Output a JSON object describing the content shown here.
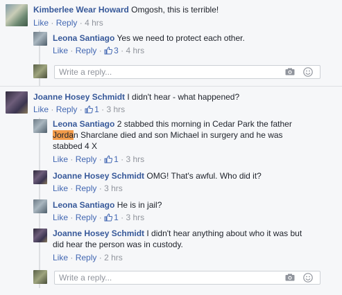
{
  "actions": {
    "like": "Like",
    "reply": "Reply",
    "sep": "·"
  },
  "comments": [
    {
      "name": "Kimberlee Wear Howard",
      "text": "Omgosh, this is terrible!",
      "likes": "",
      "time": "4 hrs"
    },
    {
      "name": "Leona Santiago",
      "text": "Yes we need to protect each other.",
      "likes": "3",
      "time": "4 hrs"
    },
    {
      "name": "Joanne Hosey Schmidt",
      "text": "I didn't hear - what happened?",
      "likes": "1",
      "time": "3 hrs"
    },
    {
      "name": "Leona Santiago",
      "text_pre": "2 stabbed this morning in Cedar Park the father",
      "text_hl": "Jorda",
      "text_post": "n Sharclane died and son Michael in surgery and he was",
      "text_line3": "stabbed 4 X",
      "likes": "1",
      "time": "3 hrs"
    },
    {
      "name": "Joanne Hosey Schmidt",
      "text": "OMG! That's awful. Who did it?",
      "likes": "",
      "time": "3 hrs"
    },
    {
      "name": "Leona Santiago",
      "text": "He is in jail?",
      "likes": "1",
      "time": "3 hrs"
    },
    {
      "name": "Joanne Hosey Schmidt",
      "text": "I didn't hear anything about who it was but",
      "text_line2": "did hear the person was in custody.",
      "likes": "",
      "time": "2 hrs"
    }
  ],
  "reply_boxes": [
    {
      "placeholder": "Write a reply..."
    },
    {
      "placeholder": "Write a reply..."
    }
  ],
  "icons": {
    "camera": "camera-icon",
    "emoji": "emoji-icon",
    "like": "thumbs-up-icon"
  },
  "colors": {
    "name": "#365899",
    "link": "#4267b2",
    "meta": "#90949c",
    "highlight": "#f29b4a"
  }
}
